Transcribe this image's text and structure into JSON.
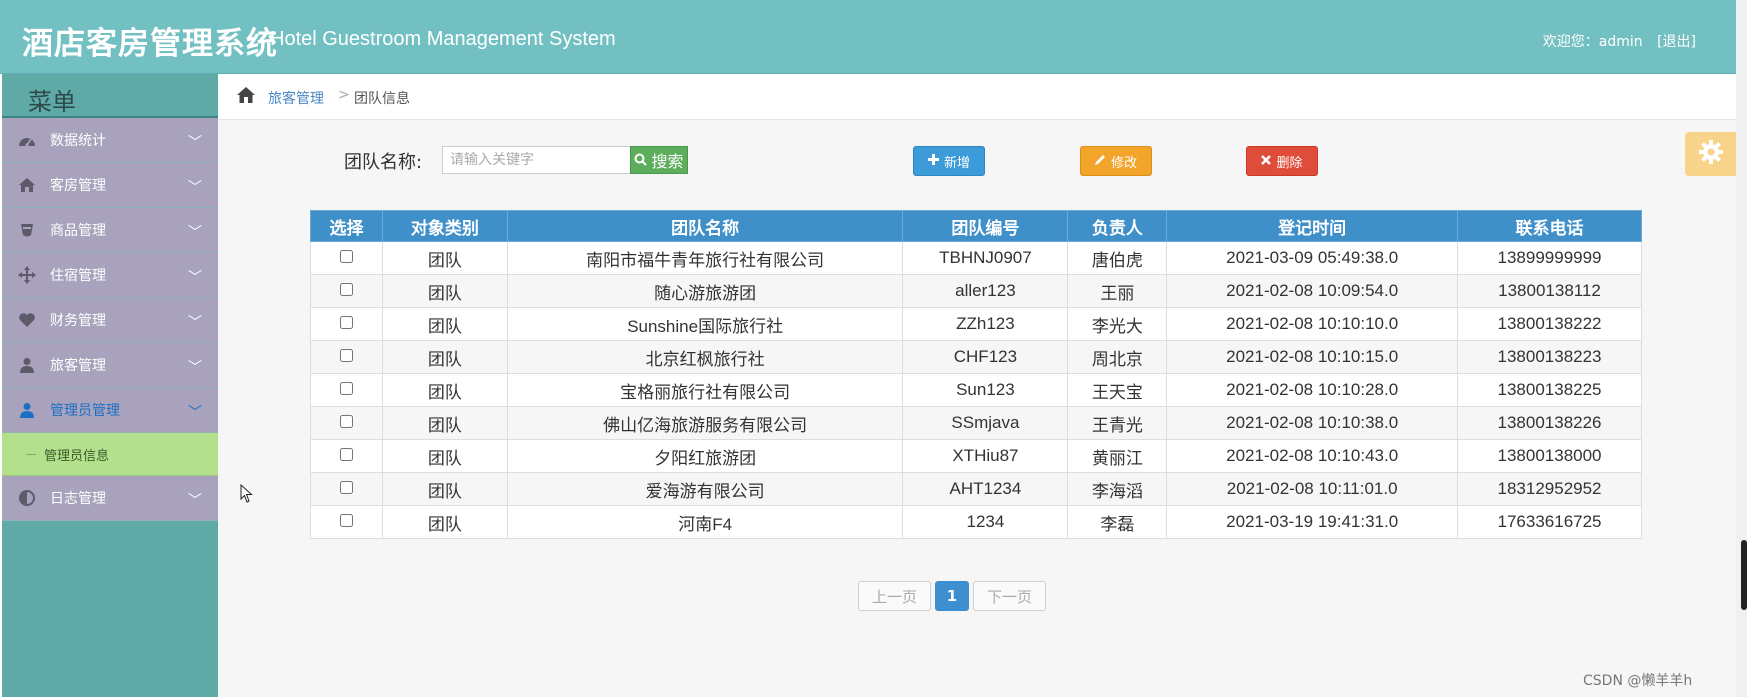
{
  "header": {
    "title_cn": "酒店客房管理系统",
    "title_en": "Hotel Guestroom Management System",
    "welcome": "欢迎您：admin",
    "logout": "[退出]"
  },
  "sidebar": {
    "menu_title": "菜单",
    "items": [
      {
        "label": "数据统计",
        "icon": "dashboard-icon"
      },
      {
        "label": "客房管理",
        "icon": "home-icon"
      },
      {
        "label": "商品管理",
        "icon": "glass-icon"
      },
      {
        "label": "住宿管理",
        "icon": "move-icon"
      },
      {
        "label": "财务管理",
        "icon": "heart-icon"
      },
      {
        "label": "旅客管理",
        "icon": "user-icon"
      },
      {
        "label": "管理员管理",
        "icon": "user-icon"
      },
      {
        "label": "日志管理",
        "icon": "adjust-icon"
      }
    ],
    "sub_item": "管理员信息"
  },
  "breadcrumb": {
    "parent": "旅客管理",
    "separator": ">",
    "current": "团队信息"
  },
  "search": {
    "label": "团队名称:",
    "placeholder": "请输入关键字",
    "button": "搜索"
  },
  "toolbar": {
    "add": "新增",
    "edit": "修改",
    "delete": "删除"
  },
  "table": {
    "headers": [
      "选择",
      "对象类别",
      "团队名称",
      "团队编号",
      "负责人",
      "登记时间",
      "联系电话"
    ],
    "rows": [
      {
        "type": "团队",
        "name": "南阳市福牛青年旅行社有限公司",
        "code": "TBHNJ0907",
        "leader": "唐伯虎",
        "time": "2021-03-09 05:49:38.0",
        "phone": "13899999999"
      },
      {
        "type": "团队",
        "name": "随心游旅游团",
        "code": "aller123",
        "leader": "王丽",
        "time": "2021-02-08 10:09:54.0",
        "phone": "13800138112"
      },
      {
        "type": "团队",
        "name": "Sunshine国际旅行社",
        "code": "ZZh123",
        "leader": "李光大",
        "time": "2021-02-08 10:10:10.0",
        "phone": "13800138222"
      },
      {
        "type": "团队",
        "name": "北京红枫旅行社",
        "code": "CHF123",
        "leader": "周北京",
        "time": "2021-02-08 10:10:15.0",
        "phone": "13800138223"
      },
      {
        "type": "团队",
        "name": "宝格丽旅行社有限公司",
        "code": "Sun123",
        "leader": "王天宝",
        "time": "2021-02-08 10:10:28.0",
        "phone": "13800138225"
      },
      {
        "type": "团队",
        "name": "佛山亿海旅游服务有限公司",
        "code": "SSmjava",
        "leader": "王青光",
        "time": "2021-02-08 10:10:38.0",
        "phone": "13800138226"
      },
      {
        "type": "团队",
        "name": "夕阳红旅游团",
        "code": "XTHiu87",
        "leader": "黄丽江",
        "time": "2021-02-08 10:10:43.0",
        "phone": "13800138000"
      },
      {
        "type": "团队",
        "name": "爱海游有限公司",
        "code": "AHT1234",
        "leader": "李海滔",
        "time": "2021-02-08 10:11:01.0",
        "phone": "18312952952"
      },
      {
        "type": "团队",
        "name": "河南F4",
        "code": "1234",
        "leader": "李磊",
        "time": "2021-03-19 19:41:31.0",
        "phone": "17633616725"
      }
    ]
  },
  "pager": {
    "prev": "上一页",
    "current": "1",
    "next": "下一页"
  },
  "watermark": "CSDN @懒羊羊h",
  "colors": {
    "header_bg": "#72c0c2",
    "sidebar_item_bg": "#a8a2bd",
    "sub_item_bg": "#b3e08c",
    "table_header_bg": "#3f8fc9",
    "add_btn": "#3d9bd9",
    "edit_btn": "#f3a52b",
    "delete_btn": "#e04c3a",
    "search_btn": "#5cad5c"
  }
}
